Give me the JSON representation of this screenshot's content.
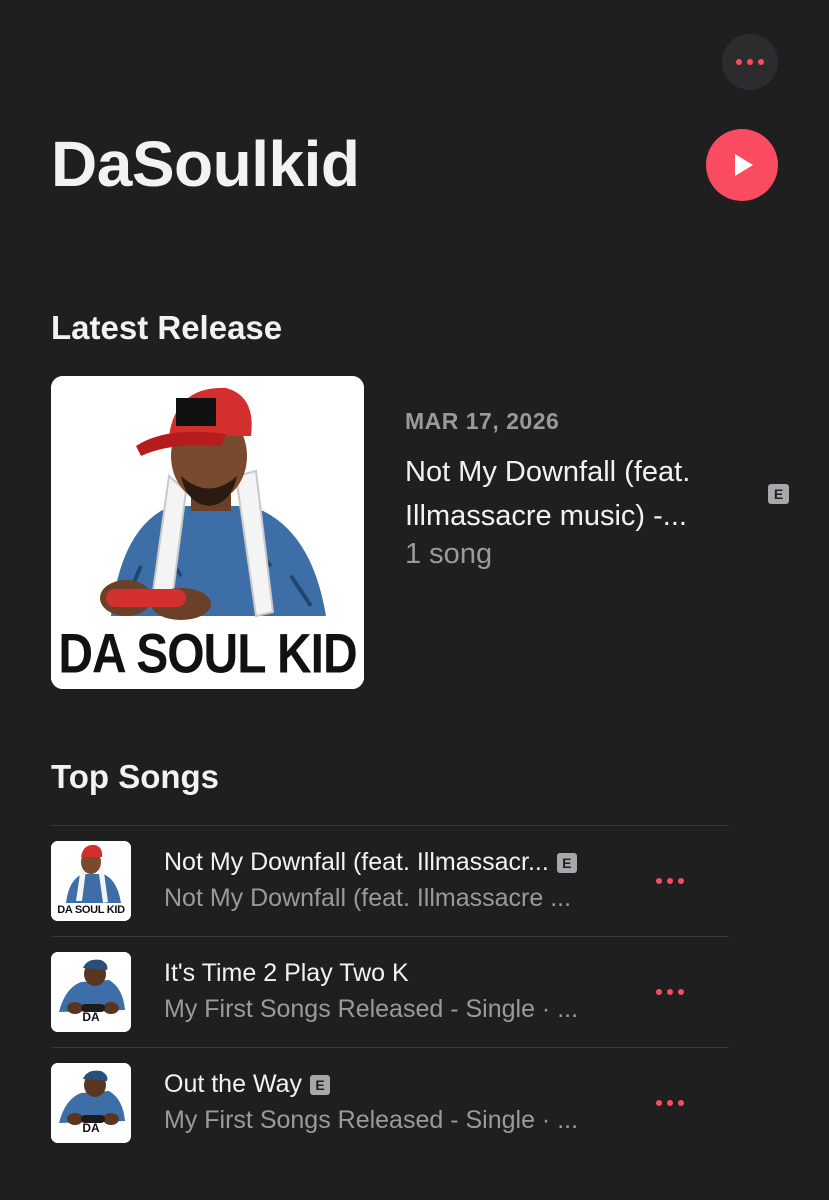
{
  "artist": {
    "name": "DaSoulkid"
  },
  "latest_release": {
    "section_title": "Latest Release",
    "date": "MAR 17, 2026",
    "title_line1": "Not My Downfall (feat.",
    "title_line2": "Illmassacre music) -...",
    "count": "1 song",
    "explicit": "E",
    "art_text": "DA SOUL KID"
  },
  "top_songs": {
    "section_title": "Top Songs",
    "items": [
      {
        "title": "Not My Downfall (feat. Illmassacr...",
        "subtitle": "Not My Downfall (feat. Illmassacre ...",
        "explicit": "E",
        "art_text": "DA SOUL KID"
      },
      {
        "title": "It's Time 2 Play Two K",
        "subtitle": "My First Songs Released - Single · ...",
        "explicit": "",
        "art_text": "DA"
      },
      {
        "title": "Out the Way",
        "subtitle": "My First Songs Released - Single · ...",
        "explicit": "E",
        "art_text": "DA"
      }
    ]
  },
  "colors": {
    "background": "#1f1f1f",
    "accent": "#fa4b60",
    "secondary_text": "#9a9a9e"
  },
  "icons": {
    "more": "ellipsis-icon",
    "play": "play-icon"
  }
}
